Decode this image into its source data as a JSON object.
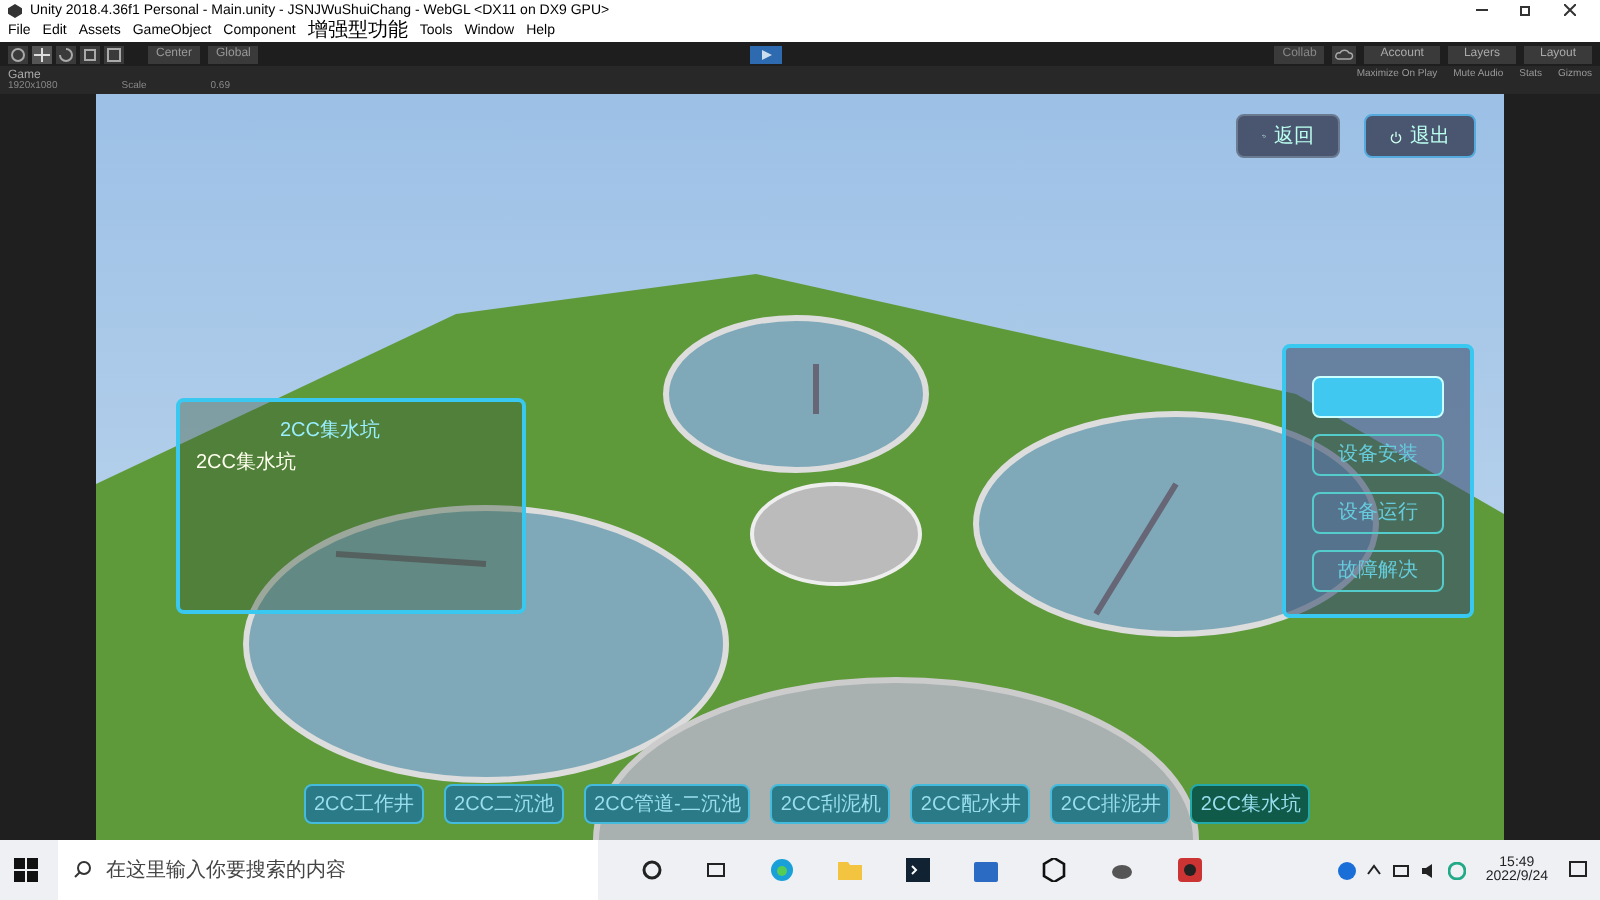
{
  "window": {
    "title": "Unity 2018.4.36f1 Personal - Main.unity - JSNJWuShuiChang - WebGL <DX11 on DX9 GPU>"
  },
  "menu": [
    "File",
    "Edit",
    "Assets",
    "GameObject",
    "Component",
    "增强型功能",
    "Tools",
    "Window",
    "Help"
  ],
  "toolbar": {
    "pivot": "Center",
    "space": "Global",
    "collab": "Collab",
    "account": "Account",
    "layers": "Layers",
    "layout": "Layout"
  },
  "game_tab": {
    "title": "Game",
    "resolution": "1920x1080",
    "scale_label": "Scale",
    "scale_value": "0.69",
    "options": [
      "Maximize On Play",
      "Mute Audio",
      "Stats",
      "Gizmos"
    ]
  },
  "top_buttons": [
    {
      "kind": "back",
      "label": "返回"
    },
    {
      "kind": "power",
      "label": "退出"
    }
  ],
  "info_panel": {
    "title": "2CC集水坑",
    "label": "2CC集水坑"
  },
  "menu_panel": {
    "items": [
      {
        "selected": true
      },
      {
        "label": "设备安装",
        "selected": false
      },
      {
        "label": "设备运行",
        "selected": false
      },
      {
        "label": "故障解决",
        "selected": false
      }
    ]
  },
  "bottom_buttons": [
    {
      "label": "2CC工作井",
      "selected": false
    },
    {
      "label": "2CC二沉池",
      "selected": false
    },
    {
      "label": "2CC管道-二沉池",
      "selected": false
    },
    {
      "label": "2CC刮泥机",
      "selected": false
    },
    {
      "label": "2CC配水井",
      "selected": false
    },
    {
      "label": "2CC排泥井",
      "selected": false
    },
    {
      "label": "2CC集水坑",
      "selected": true
    }
  ],
  "taskbar": {
    "search_placeholder": "在这里输入你要搜索的内容",
    "time": "15:49",
    "date": "2022/9/24"
  }
}
